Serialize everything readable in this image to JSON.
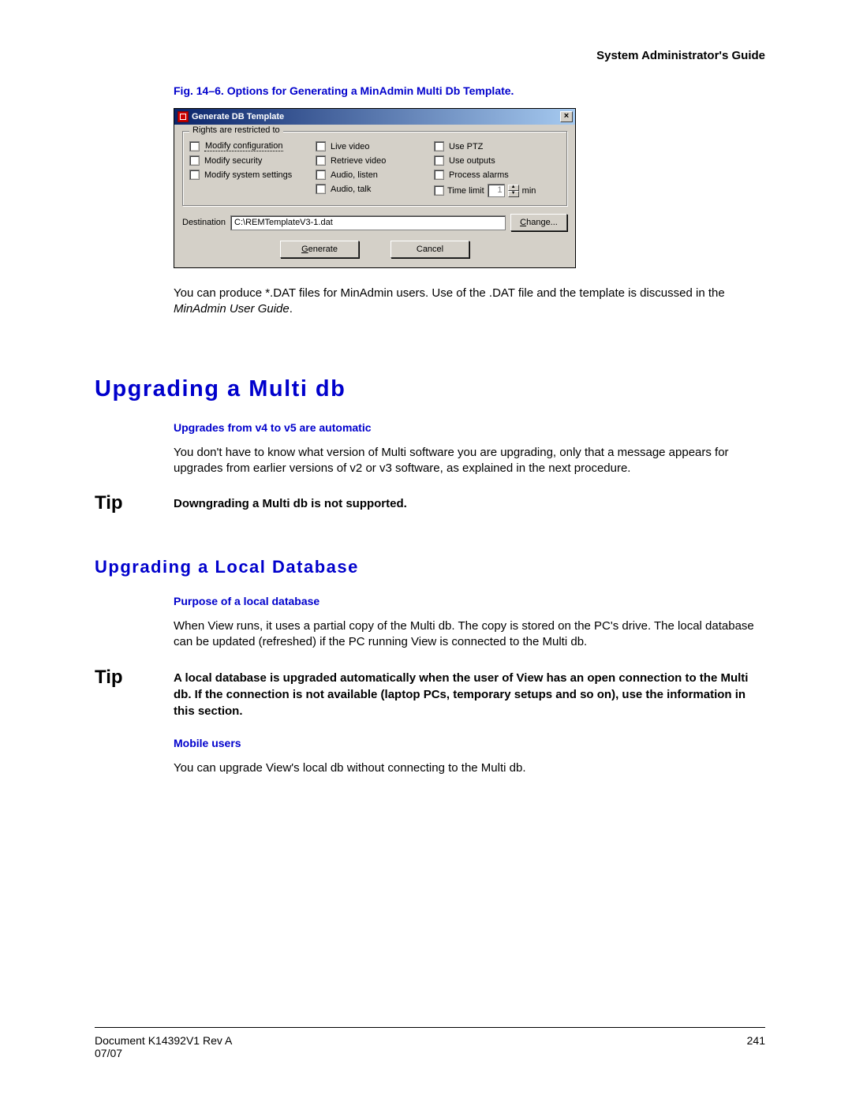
{
  "header": {
    "title": "System Administrator's Guide"
  },
  "figure": {
    "caption": "Fig. 14–6.   Options for Generating a MinAdmin Multi Db Template."
  },
  "dialog": {
    "title": "Generate DB Template",
    "close": "×",
    "group_title": "Rights are restricted to",
    "col1": {
      "a": "Modify configuration",
      "b": "Modify security",
      "c": "Modify system settings"
    },
    "col2": {
      "a": "Live video",
      "b": "Retrieve video",
      "c": "Audio, listen",
      "d": "Audio, talk"
    },
    "col3": {
      "a": "Use PTZ",
      "b": "Use outputs",
      "c": "Process alarms",
      "d": "Time limit",
      "spin_value": "1",
      "spin_unit": "min"
    },
    "dest_label": "Destination",
    "dest_value": "C:\\REMTemplateV3-1.dat",
    "change_btn": "Change...",
    "generate_btn": "Generate",
    "cancel_btn": "Cancel"
  },
  "para1_a": "You can produce *.DAT files for MinAdmin users. Use of the .DAT file and the template is discussed in the ",
  "para1_em": "MinAdmin User Guide",
  "para1_b": ".",
  "h1": "Upgrading a Multi db",
  "h3a": "Upgrades from v4 to v5 are automatic",
  "para2": "You don't have to know what version of Multi software you are upgrading, only that a message appears for upgrades from earlier versions of v2 or v3 software, as explained in the next procedure.",
  "tip_label": "Tip",
  "tip1": "Downgrading a Multi db is not supported.",
  "h2": "Upgrading a Local Database",
  "h3b": "Purpose of a local database",
  "para3": "When View runs, it uses a partial copy of the Multi db. The copy is stored on the PC's drive. The local database can be updated (refreshed) if the PC running View is connected to the Multi db.",
  "tip2": "A local database is upgraded automatically when the user of View has an open connection to the Multi db. If the connection is not available (laptop PCs, temporary setups and so on), use the information in this section.",
  "h3c": "Mobile users",
  "para4": "You can upgrade View's local db without connecting to the Multi db.",
  "footer": {
    "doc": "Document K14392V1 Rev A",
    "date": "07/07",
    "page": "241"
  }
}
